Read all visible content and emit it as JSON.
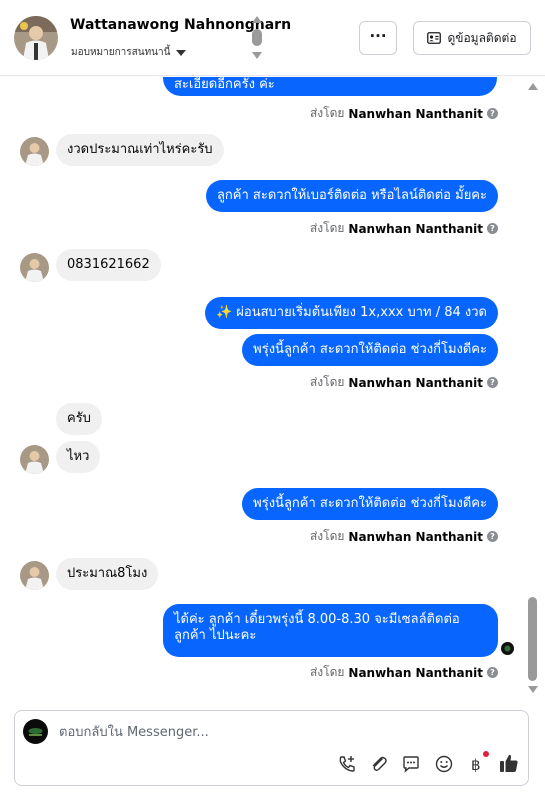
{
  "header": {
    "contact_name": "Wattanawong Nahnongharn",
    "assign_label": "มอบหมายการสนทนานี้",
    "more_label": "···",
    "contact_info_label": "ดูข้อมูลติดต่อ"
  },
  "messages": [
    {
      "dir": "out",
      "text": "สะเอียดอีกครั้ง ค่ะ",
      "partial": true
    },
    {
      "dir": "sent_by",
      "label": "ส่งโดย",
      "sender": "Nanwhan Nanthanit"
    },
    {
      "dir": "in",
      "text": "งวดประมาณเท่าไหร่คะรับ"
    },
    {
      "dir": "out",
      "text": "ลูกค้า สะดวกให้เบอร์ติดต่อ หรือไลน์ติดต่อ มั้ยคะ"
    },
    {
      "dir": "sent_by",
      "label": "ส่งโดย",
      "sender": "Nanwhan Nanthanit"
    },
    {
      "dir": "in",
      "text": "0831621662"
    },
    {
      "dir": "out",
      "text": "✨ ผ่อนสบายเริ่มต้นเพียง 1x,xxx บาท / 84 งวด"
    },
    {
      "dir": "out",
      "text": "พรุ่งนี้ลูกค้า สะดวกให้ติดต่อ ช่วงกี่โมงดีคะ"
    },
    {
      "dir": "sent_by",
      "label": "ส่งโดย",
      "sender": "Nanwhan Nanthanit"
    },
    {
      "dir": "in",
      "text": "ครับ"
    },
    {
      "dir": "in",
      "text": "ไหว"
    },
    {
      "dir": "out",
      "text": "พรุ่งนี้ลูกค้า สะดวกให้ติดต่อ ช่วงกี่โมงดีคะ"
    },
    {
      "dir": "sent_by",
      "label": "ส่งโดย",
      "sender": "Nanwhan Nanthanit"
    },
    {
      "dir": "in",
      "text": "ประมาณ8โมง"
    },
    {
      "dir": "out",
      "line1": "ได้ค่ะ  ลูกค้า เดี๋ยวพรุ่งนี้  8.00-8.30 จะมีเซลล์ติดต่อ",
      "line2": "ลูกค้า ไปนะคะ"
    },
    {
      "dir": "sent_by",
      "label": "ส่งโดย",
      "sender": "Nanwhan Nanthanit"
    }
  ],
  "composer": {
    "placeholder": "ตอบกลับใน Messenger...",
    "tools": [
      "call-add-icon",
      "attachment-icon",
      "saved-replies-icon",
      "emoji-icon",
      "baht-payment-icon",
      "thumbs-up-icon"
    ]
  },
  "colors": {
    "outgoing_bubble": "#0866ff",
    "incoming_bubble": "#f0f0f0",
    "secondary_text": "#65676b"
  }
}
